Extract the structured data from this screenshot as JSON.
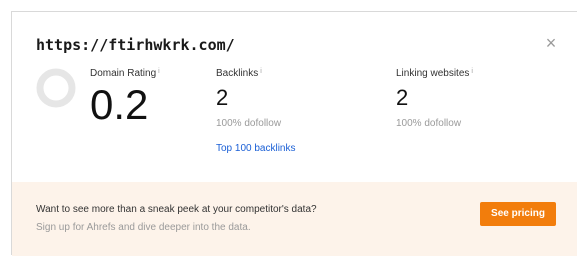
{
  "background_text": "",
  "header": {
    "url": "https://ftirhwkrk.com/",
    "close_glyph": "×"
  },
  "metrics": {
    "domain_rating": {
      "label": "Domain Rating",
      "info_glyph": "i",
      "value": "0.2",
      "ring_color": "#e6e6e6"
    },
    "backlinks": {
      "label": "Backlinks",
      "info_glyph": "i",
      "value": "2",
      "sub": "100% dofollow",
      "link": "Top 100 backlinks"
    },
    "linking_websites": {
      "label": "Linking websites",
      "info_glyph": "i",
      "value": "2",
      "sub": "100% dofollow"
    }
  },
  "footer": {
    "line1": "Want to see more than a sneak peek at your competitor's data?",
    "line2": "Sign up for Ahrefs and dive deeper into the data.",
    "cta_label": "See pricing"
  },
  "colors": {
    "accent": "#f27d0c",
    "link": "#1a5fd6",
    "footer_bg": "#fdf3ea"
  }
}
